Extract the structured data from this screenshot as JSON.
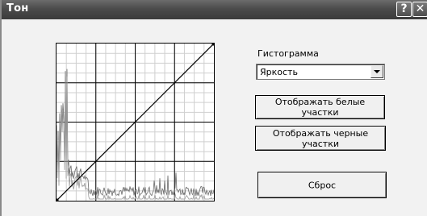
{
  "window": {
    "title": "Тон",
    "help_label": "?",
    "close_label": "✕"
  },
  "histogram": {
    "label": "Гистограмма",
    "channel_selected": "Яркость"
  },
  "buttons": {
    "show_white": "Отображать белые участки",
    "show_black": "Отображать черные участки",
    "reset": "Сброс"
  },
  "curve": {
    "input_range": [
      0,
      255
    ],
    "output_range": [
      0,
      255
    ],
    "points": [
      [
        0,
        0
      ],
      [
        255,
        255
      ]
    ]
  },
  "colors": {
    "titlebar": "#4b4b4b",
    "panel": "#f2f2f2",
    "grid": "#000000",
    "histogram": "#6a6a6a"
  }
}
